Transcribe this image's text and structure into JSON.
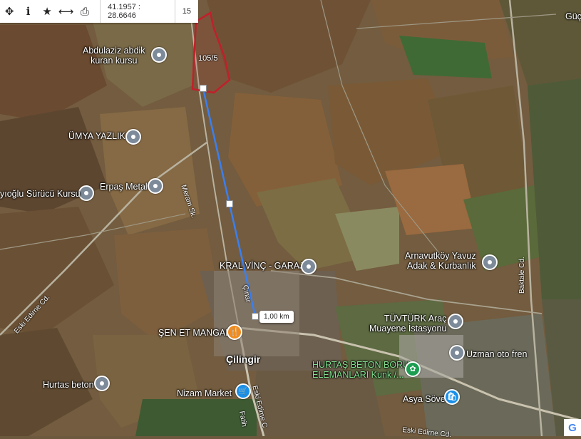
{
  "toolbar": {
    "icons": [
      "move-icon",
      "info-icon",
      "star-icon",
      "measure-icon",
      "print-icon"
    ],
    "coordinates": "41.1957 : 28.6646",
    "zoom": "15"
  },
  "parcel": {
    "label": "105/5",
    "outline_color": "#c0202a"
  },
  "measure": {
    "distance": "1,00 km",
    "line_color": "#3b7ff0"
  },
  "places": {
    "abdulaziz": "Abdulaziz abdik\nkuran kursu",
    "umya": "ÜMYA YAZLIK",
    "erpas": "Erpaş Metal",
    "surucu": "yıoğlu Sürücü Kursu",
    "kral": "KRAL VİNÇ - GARAJ",
    "arnavutkoy": "Arnavutköy Yavuz\nAdak & Kurbanlık",
    "tuvturk": "TÜVTÜRK Araç\nMuayene İstasyonu",
    "uzman": "Uzman oto fren",
    "sen_et": "ŞEN ET MANGAL",
    "cilingir": "Çilingir",
    "hurtas_beton": "Hurtas beton",
    "hurtas_boru": "HURTAŞ BETON BORU\nELEMANLARI Kunk /...",
    "nizam": "Nizam Market",
    "asya": "Asya Söve",
    "guc": "Güç"
  },
  "roads": {
    "meram": "Meram Sk.",
    "eski_edirne_left": "Eski Edirne Cd.",
    "eski_edirne_bottom": "Eski Edirne Cd.",
    "eski_edirne_vert": "Eski Edirne C",
    "fatih": "Fatih",
    "baktale": "Baktale Cd.",
    "cinar": "Çınar"
  },
  "logo": "G"
}
